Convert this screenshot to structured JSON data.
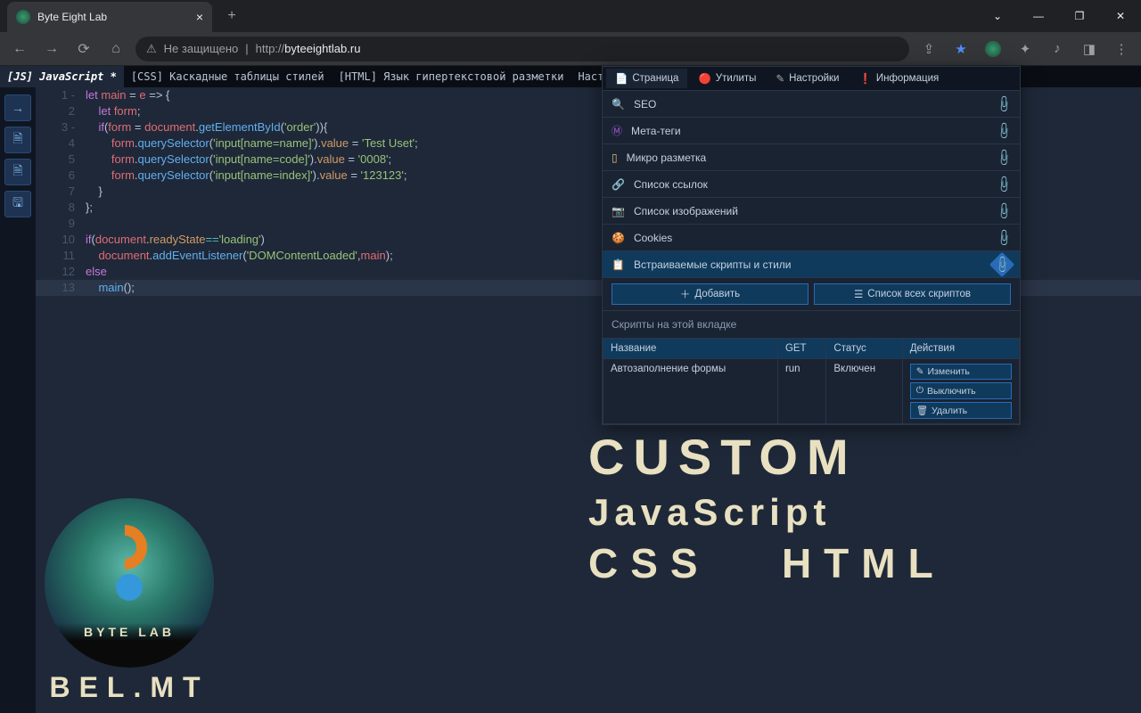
{
  "browser": {
    "tab_title": "Byte Eight Lab",
    "security_label": "Не защищено",
    "url_prefix": "http://",
    "url_host": "byteeightlab.ru"
  },
  "editor_tabs": [
    {
      "label": "[JS] JavaScript *",
      "active": true
    },
    {
      "label": "[CSS] Каскадные таблицы стилей",
      "active": false
    },
    {
      "label": "[HTML] Язык гипертекстовой разметки",
      "active": false
    },
    {
      "label": "Настройки",
      "active": false
    }
  ],
  "code_lines": [
    {
      "n": "1",
      "marker": "-",
      "html": "<span class='k'>let</span> <span class='d'>main</span> = <span class='d'>e</span> =&gt; {"
    },
    {
      "n": "2",
      "marker": "",
      "html": "    <span class='k'>let</span> <span class='d'>form</span>;"
    },
    {
      "n": "3",
      "marker": "-",
      "html": "    <span class='k'>if</span>(<span class='d'>form</span> = <span class='d'>document</span>.<span class='m'>getElementById</span>(<span class='s'>'order'</span>)){"
    },
    {
      "n": "4",
      "marker": "",
      "html": "        <span class='d'>form</span>.<span class='m'>querySelector</span>(<span class='s'>'input[name=name]'</span>).<span class='p'>value</span> = <span class='s'>'Test Uset'</span>;"
    },
    {
      "n": "5",
      "marker": "",
      "html": "        <span class='d'>form</span>.<span class='m'>querySelector</span>(<span class='s'>'input[name=code]'</span>).<span class='p'>value</span> = <span class='s'>'0008'</span>;"
    },
    {
      "n": "6",
      "marker": "",
      "html": "        <span class='d'>form</span>.<span class='m'>querySelector</span>(<span class='s'>'input[name=index]'</span>).<span class='p'>value</span> = <span class='s'>'123123'</span>;"
    },
    {
      "n": "7",
      "marker": "",
      "html": "    }"
    },
    {
      "n": "8",
      "marker": "",
      "html": "};"
    },
    {
      "n": "9",
      "marker": "",
      "html": ""
    },
    {
      "n": "10",
      "marker": "",
      "html": "<span class='k'>if</span>(<span class='d'>document</span>.<span class='p'>readyState</span><span class='o'>==</span><span class='s'>'loading'</span>)"
    },
    {
      "n": "11",
      "marker": "",
      "html": "    <span class='d'>document</span>.<span class='m'>addEventListener</span>(<span class='s'>'DOMContentLoaded'</span>,<span class='d'>main</span>);"
    },
    {
      "n": "12",
      "marker": "",
      "html": "<span class='k'>else</span>"
    },
    {
      "n": "13",
      "marker": "",
      "html": "    <span class='m'>main</span>();",
      "hl": true
    }
  ],
  "panel": {
    "tabs": [
      {
        "icon": "📄",
        "label": "Страница",
        "active": true,
        "color": "#fff"
      },
      {
        "icon": "🔴",
        "label": "Утилиты",
        "active": false,
        "color": "#e06c75"
      },
      {
        "icon": "✎",
        "label": "Настройки",
        "active": false,
        "color": "#aaa"
      },
      {
        "icon": "❗",
        "label": "Информация",
        "active": false,
        "color": "#e5c07b"
      }
    ],
    "items": [
      {
        "icon": "🔍",
        "label": "SEO",
        "active": false
      },
      {
        "icon": "Ⓜ",
        "label": "Мета-теги",
        "active": false,
        "icolor": "#a259d9"
      },
      {
        "icon": "▯",
        "label": "Микро разметка",
        "active": false,
        "icolor": "#e5c07b"
      },
      {
        "icon": "🔗",
        "label": "Список ссылок",
        "active": false
      },
      {
        "icon": "📷",
        "label": "Список изображений",
        "active": false
      },
      {
        "icon": "🍪",
        "label": "Cookies",
        "active": false
      },
      {
        "icon": "📋",
        "label": "Встраиваемые скрипты и стили",
        "active": true
      }
    ],
    "add_btn": "Добавить",
    "list_btn": "Список всех скриптов",
    "section_title": "Скрипты на этой вкладке",
    "table": {
      "headers": [
        "Название",
        "GET",
        "Статус",
        "Действия"
      ],
      "row": {
        "name": "Автозаполнение формы",
        "get": "run",
        "status": "Включен",
        "actions": [
          {
            "icon": "✎",
            "label": "Изменить"
          },
          {
            "icon": "⏻",
            "label": "Выключить"
          },
          {
            "icon": "🗑",
            "label": "Удалить"
          }
        ]
      }
    }
  },
  "big_text": {
    "l1": "CUSTOM",
    "l2": "JavaScript",
    "l3_a": "CSS",
    "l3_b": "HTML"
  },
  "logo": {
    "line1": "BYTE  LAB",
    "line2": "BEL.MT"
  }
}
